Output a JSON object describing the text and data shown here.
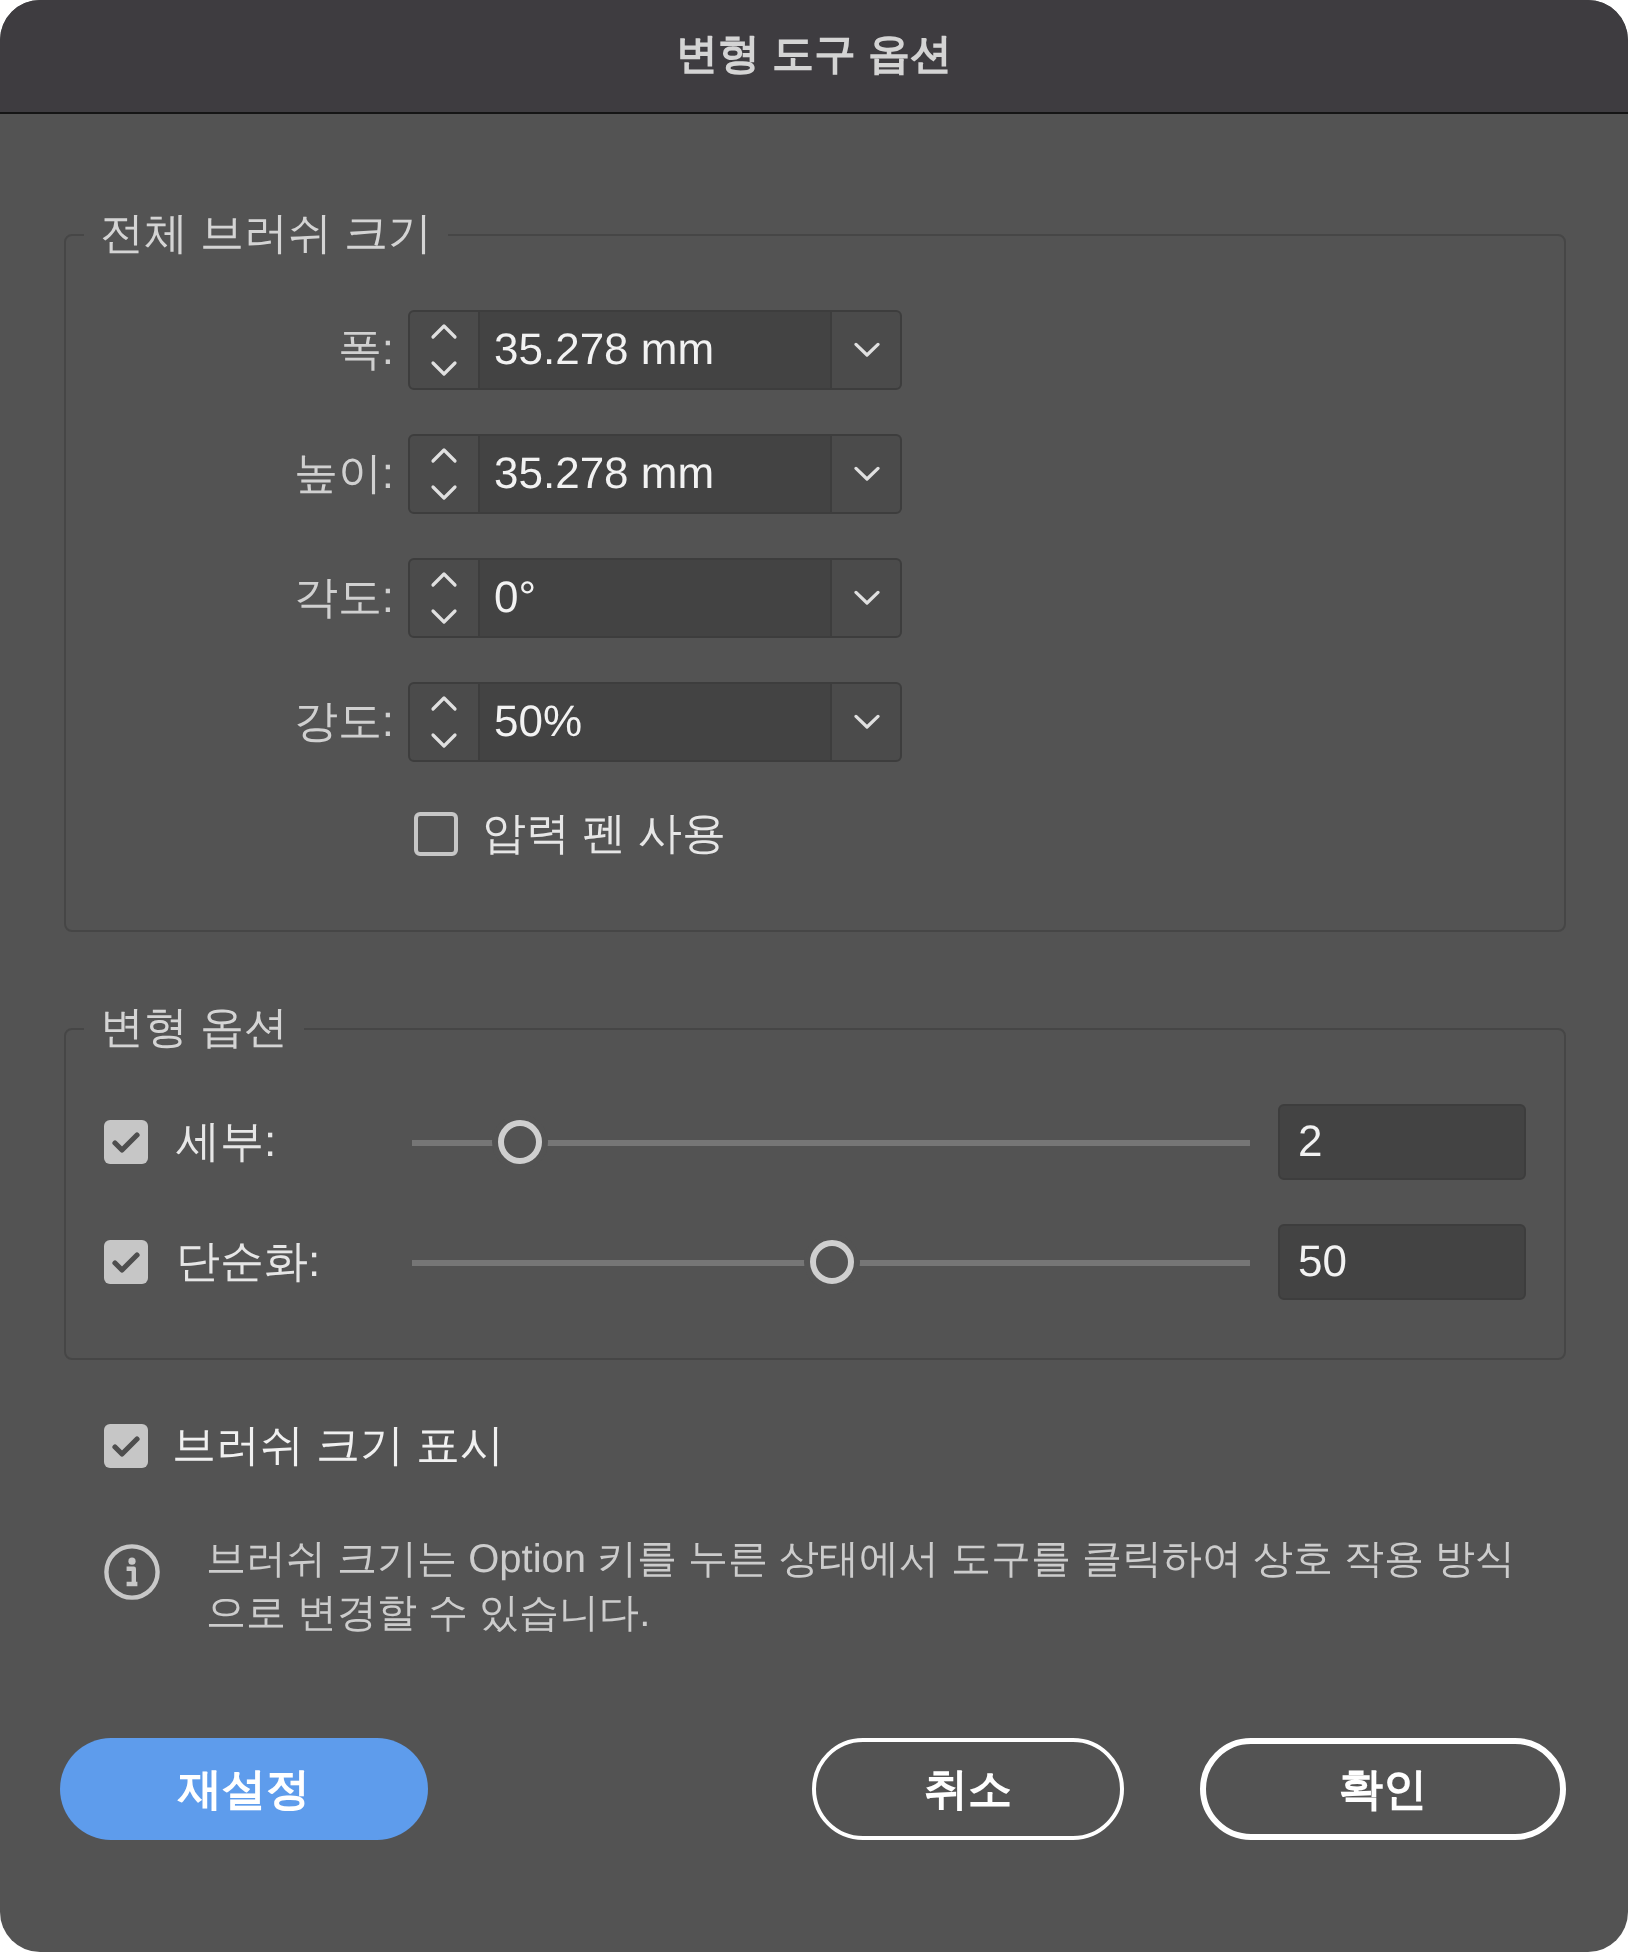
{
  "window": {
    "title": "변형 도구 옵션"
  },
  "brush_size": {
    "legend": "전체 브러쉬 크기",
    "fields": [
      {
        "label": "폭:",
        "value": "35.278 mm"
      },
      {
        "label": "높이:",
        "value": "35.278 mm"
      },
      {
        "label": "각도:",
        "value": "0°"
      },
      {
        "label": "강도:",
        "value": "50%"
      }
    ],
    "pressure_pen": {
      "label": "압력 펜 사용",
      "checked": false
    }
  },
  "deform_options": {
    "legend": "변형 옵션",
    "sliders": [
      {
        "label": "세부:",
        "checked": true,
        "level": 0.13,
        "value": "2"
      },
      {
        "label": "단순화:",
        "checked": true,
        "level": 0.5,
        "value": "50"
      }
    ]
  },
  "show_brush_size": {
    "label": "브러쉬 크기 표시",
    "checked": true
  },
  "info": {
    "text": "브러쉬 크기는 Option 키를 누른 상태에서 도구를 클릭하여 상호 작용 방식으로 변경할 수 있습니다."
  },
  "buttons": [
    {
      "label": "재설정",
      "kind": "primary"
    },
    {
      "label": "취소",
      "kind": "secondary"
    },
    {
      "label": "확인",
      "kind": "default"
    }
  ]
}
